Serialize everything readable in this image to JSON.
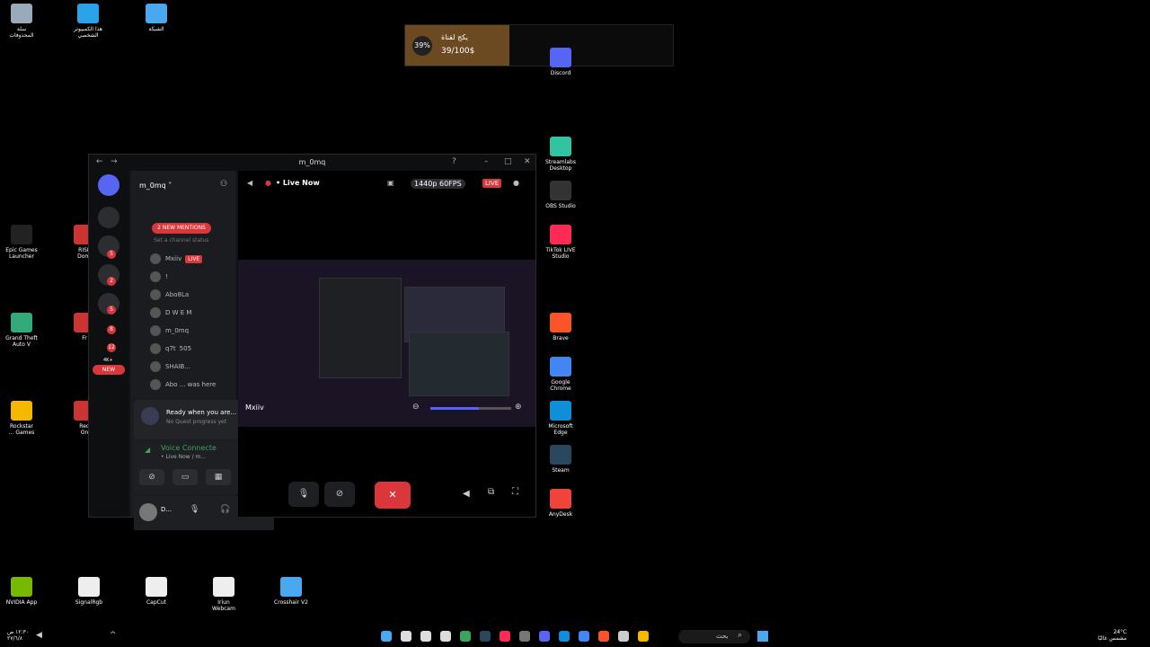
{
  "desktop_left": [
    {
      "name": "recycle-bin",
      "label": "سلة\nالمحذوفات",
      "color": "#9ab"
    },
    {
      "name": "this-pc",
      "label": "هذا الكمبيوتر\nالشخصي",
      "color": "#2aa3e8"
    },
    {
      "name": "network",
      "label": "الشبكة",
      "color": "#4aa8f0"
    },
    {
      "name": "epic-games",
      "label": "Epic Games\nLauncher",
      "color": "#222"
    },
    {
      "name": "risk",
      "label": "RISK\nDomi",
      "color": "#c33"
    },
    {
      "name": "gta-v",
      "label": "Grand Theft\nAuto V",
      "color": "#3a7"
    },
    {
      "name": "fr-app",
      "label": "Fr",
      "color": "#c33"
    },
    {
      "name": "rockstar",
      "label": "Rockstar\n... Games",
      "color": "#f5b800"
    },
    {
      "name": "red-online",
      "label": "Red\nOn",
      "color": "#c33"
    }
  ],
  "desktop_right": [
    {
      "name": "discord",
      "label": "Discord",
      "color": "#5865f2"
    },
    {
      "name": "streamlabs",
      "label": "Streamlabs\nDesktop",
      "color": "#31c3a2"
    },
    {
      "name": "obs",
      "label": "OBS Studio",
      "color": "#333"
    },
    {
      "name": "tiktok-live",
      "label": "TikTok LIVE\nStudio",
      "color": "#fe2c55"
    },
    {
      "name": "brave",
      "label": "Brave",
      "color": "#fb542b"
    },
    {
      "name": "chrome",
      "label": "Google\nChrome",
      "color": "#4285f4"
    },
    {
      "name": "edge",
      "label": "Microsoft\nEdge",
      "color": "#0f8fd8"
    },
    {
      "name": "steam",
      "label": "Steam",
      "color": "#2a475e"
    },
    {
      "name": "anydesk",
      "label": "AnyDesk",
      "color": "#ef443b"
    }
  ],
  "desktop_bottom": [
    {
      "name": "nvidia",
      "label": "NVIDIA App",
      "color": "#76b900"
    },
    {
      "name": "signalrgb",
      "label": "SignalRgb",
      "color": "#eee"
    },
    {
      "name": "capcut",
      "label": "CapCut",
      "color": "#eee"
    },
    {
      "name": "iriun",
      "label": "Iriun\nWebcam",
      "color": "#eee"
    },
    {
      "name": "crosshair",
      "label": "Crosshair V2",
      "color": "#4aa8f0"
    }
  ],
  "goal": {
    "percent": "39%",
    "title": "يكج لقناة",
    "progress": "39/100$",
    "fill_fraction": 0.39
  },
  "window": {
    "title": "m_0mq",
    "server_name": "m_0mq",
    "live_now": "• Live Now",
    "quality": "1440p 60FPS",
    "live_badge": "LIVE"
  },
  "channel": {
    "mentions": "2 NEW MENTIONS",
    "status_placeholder": "Set a channel status",
    "members": [
      {
        "name": "Mxiiv",
        "tag": "LIVE"
      },
      {
        "name": "!",
        "tag": ""
      },
      {
        "name": "Abo8La",
        "tag": ""
      },
      {
        "name": "D W E M",
        "tag": ""
      },
      {
        "name": "m_0mq",
        "tag": ""
      },
      {
        "name": "q7t",
        "tag": "505"
      },
      {
        "name": "SHAIB...",
        "tag": ""
      },
      {
        "name": "Abo ... was here",
        "tag": ""
      }
    ]
  },
  "quest": {
    "title": "Ready when you are...",
    "sub": "No Quest progress yet"
  },
  "voice": {
    "status": "Voice Connecte",
    "sub": "• Live Now / m..."
  },
  "user": {
    "name": "D..."
  },
  "server_badges": [
    "5",
    "2",
    "5",
    "8",
    "12"
  ],
  "new_label": "NEW",
  "server_4k": "4K+",
  "stream": {
    "streamer": "Mxiiv",
    "volume_fraction": 0.6
  },
  "taskbar": {
    "search_placeholder": "بحث",
    "clock_time": "١٢:٣٠ ص",
    "clock_date": "٢٧/٦/٨",
    "weather": "24°C",
    "weather_sub": "مشمس غالبًا"
  }
}
